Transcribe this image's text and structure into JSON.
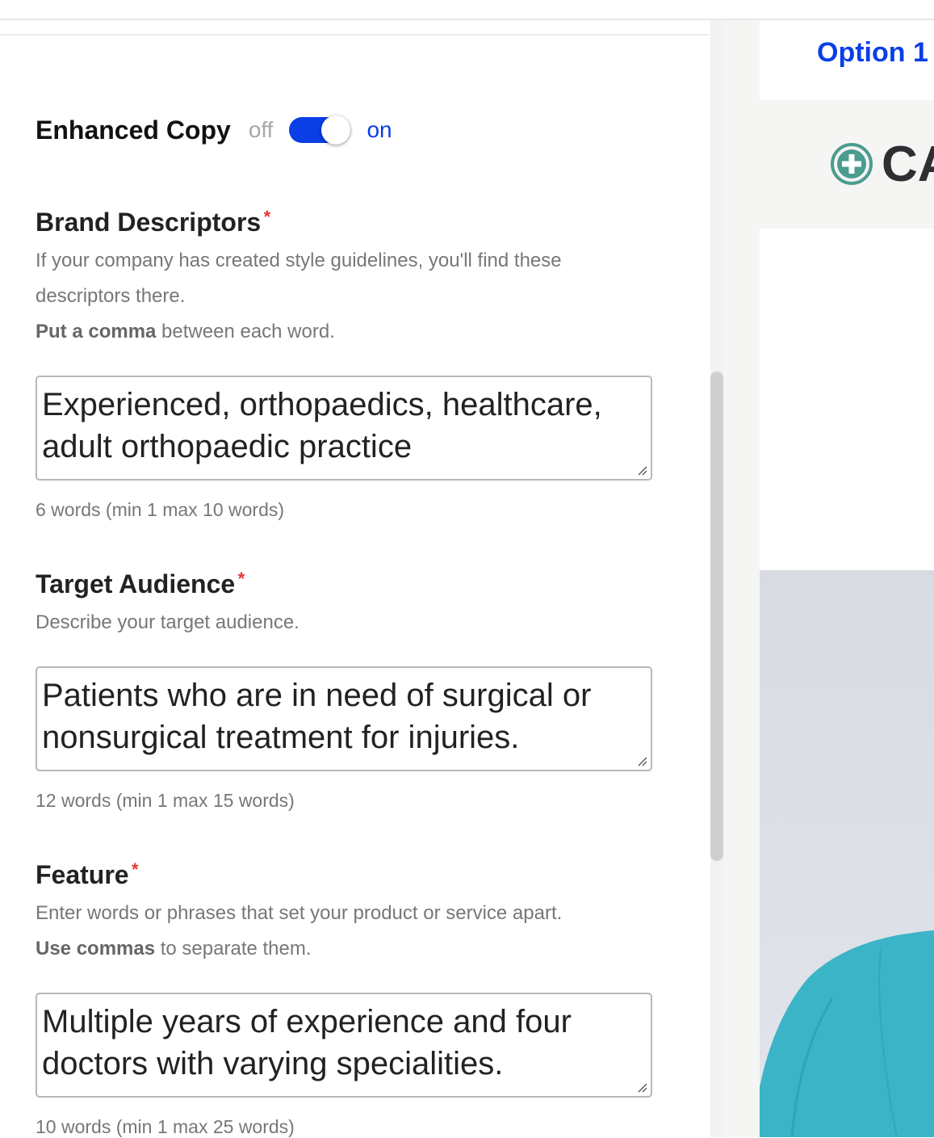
{
  "toggle": {
    "title": "Enhanced Copy",
    "off_label": "off",
    "on_label": "on",
    "state": "on"
  },
  "fields": [
    {
      "label": "Brand Descriptors",
      "required_mark": "*",
      "help_line1": "If your company has created style guidelines, you'll find these",
      "help_line2": "descriptors there.",
      "hint_bold": "Put a comma",
      "hint_rest": " between each word.",
      "value_line1": "Experienced, orthopaedics, healthcare,",
      "value_line2": "adult orthopaedic practice",
      "count": "6 words (min 1 max 10 words)"
    },
    {
      "label": "Target Audience",
      "required_mark": "*",
      "help_line1": "Describe your target audience.",
      "value_line1": "Patients who are in need of surgical or",
      "value_line2": "nonsurgical treatment for injuries.",
      "count": "12 words (min 1 max 15 words)"
    },
    {
      "label": "Feature",
      "required_mark": "*",
      "help_line1": "Enter words or phrases that set your product or service apart.",
      "hint_bold": "Use commas",
      "hint_rest": " to separate them.",
      "value_line1": "Multiple years of experience and four",
      "value_line2": "doctors with varying specialities.",
      "count": "10 words (min 1 max 25 words)"
    }
  ],
  "preview": {
    "option_label": "Option 1",
    "logo_text": "CA",
    "accent_color": "#0a3ee6",
    "logo_color": "#4a9d8f"
  }
}
